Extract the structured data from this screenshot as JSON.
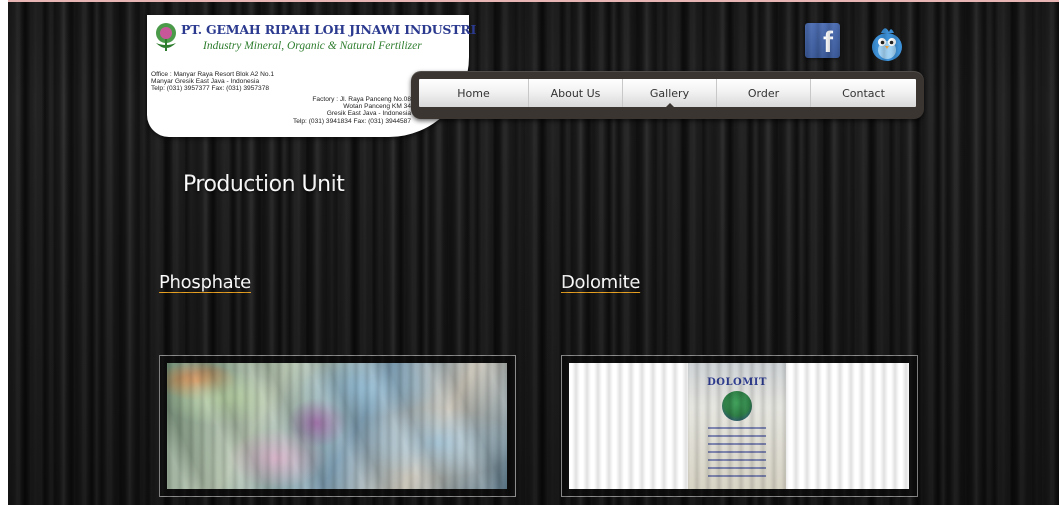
{
  "company": {
    "name": "PT. GEMAH RIPAH LOH JINAWI INDUSTRI",
    "tagline": "Industry Mineral, Organic & Natural Fertilizer",
    "office_lines": [
      "Office : Manyar Raya Resort Blok A2 No.1",
      "Manyar Gresik East Java - Indonesia",
      "Telp: (031) 3957377  Fax: (031) 3957378"
    ],
    "factory_lines": [
      "Factory : Jl. Raya Panceng No.08",
      "Wotan Panceng KM 34",
      "Gresik East Java - Indonesia",
      "Telp: (031) 3941834  Fax: (031) 3944587"
    ]
  },
  "nav": {
    "items": [
      {
        "label": "Home"
      },
      {
        "label": "About Us"
      },
      {
        "label": "Gallery"
      },
      {
        "label": "Order"
      },
      {
        "label": "Contact"
      }
    ],
    "active": "Gallery"
  },
  "social": {
    "facebook_icon": "facebook-icon",
    "twitter_icon": "twitter-bird-icon",
    "facebook_glyph": "f"
  },
  "page": {
    "title": "Production Unit"
  },
  "gallery": {
    "categories": [
      {
        "label": "Phosphate"
      },
      {
        "label": "Dolomite"
      }
    ],
    "dolomite_bag_brand": "DOLOMIT"
  },
  "colors": {
    "nav_frame": "#3a3531",
    "company_name": "#2b3a8f",
    "tagline": "#2e7d2e",
    "link_underline": "#e8a020",
    "facebook": "#3b5998"
  }
}
